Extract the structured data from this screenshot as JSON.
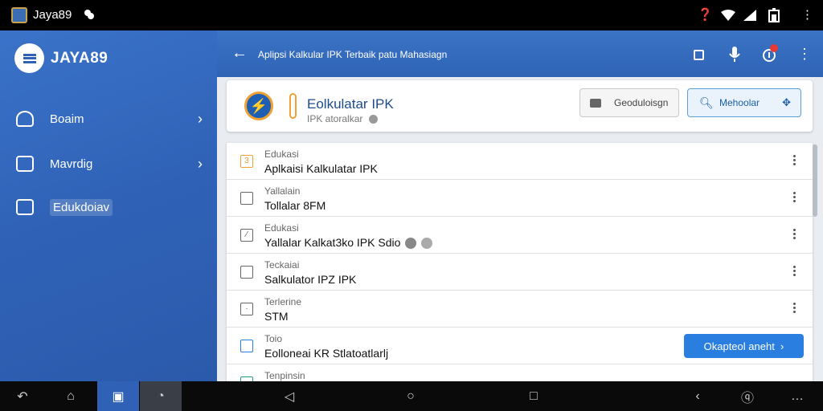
{
  "status_bar": {
    "app_name": "Jaya89",
    "icons": [
      "help-circle-icon",
      "wifi-icon",
      "signal-icon",
      "battery-icon",
      "more-vert-icon"
    ]
  },
  "sidebar": {
    "brand": "JAYA89",
    "items": [
      {
        "label": "Boaim",
        "icon": "badge-icon",
        "has_chevron": true
      },
      {
        "label": "Mavrdig",
        "icon": "calendar-icon",
        "has_chevron": true
      },
      {
        "label": "Edukdoiav",
        "icon": "folder-icon",
        "has_chevron": false
      }
    ]
  },
  "app_bar": {
    "title": "Aplipsi Kalkular IPK Terbaik patu Mahasiagn",
    "actions": [
      "square-icon",
      "mic-icon",
      "notification-icon",
      "more-vert-icon"
    ]
  },
  "header_card": {
    "title": "Eolkulatar IPK",
    "subtitle": "IPK atoralkar",
    "button1_label": "Geoduloisgn",
    "button2_label": "Mehoolar"
  },
  "list": {
    "rows": [
      {
        "small": "Edukasi",
        "main": "Aplkaisi Kalkulatar IPK",
        "icon": "number-icon"
      },
      {
        "small": "Yallalain",
        "main": "Tollalar 8FM",
        "icon": "checkbox-icon"
      },
      {
        "small": "Edukasi",
        "main": "Yallalar Kalkat3ko IPK Sdio",
        "icon": "edit-icon"
      },
      {
        "small": "Teckaiai",
        "main": "Salkulator IPZ IPK",
        "icon": "checkbox-icon"
      },
      {
        "small": "Terlerine",
        "main": "STM",
        "icon": "dot-icon"
      },
      {
        "small": "Toio",
        "main": "Eolloneai KR Stlatoatlarlj",
        "icon": "checkbox-icon",
        "button": "Okapteol aneht"
      },
      {
        "small": "Tenpinsin",
        "main": "",
        "icon": "checkbox-icon"
      }
    ]
  },
  "nav_bar": {
    "buttons": [
      "back-icon",
      "home-icon",
      "recents-icon",
      "gallery-icon",
      "triangle-back-icon",
      "circle-home-icon",
      "square-recents-icon",
      "chevron-left-icon",
      "chat-icon",
      "more-horiz-icon"
    ]
  }
}
